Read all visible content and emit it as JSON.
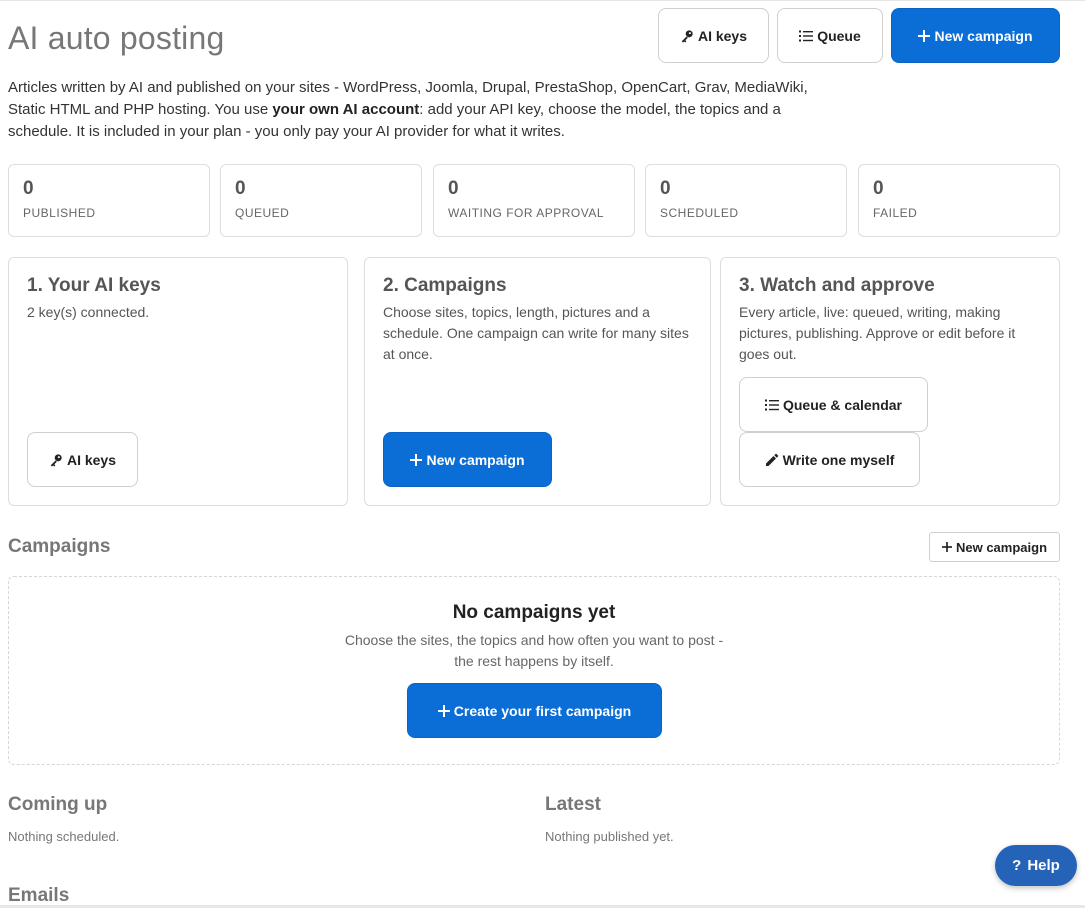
{
  "header": {
    "title": "AI auto posting",
    "ai_keys_label": "AI keys",
    "queue_label": "Queue",
    "new_campaign_label": "New campaign"
  },
  "intro": {
    "part1": "Articles written by AI and published on your sites - WordPress, Joomla, Drupal, PrestaShop, OpenCart, Grav, MediaWiki, Static HTML and PHP hosting. You use ",
    "bold": "your own AI account",
    "part2": ": add your API key, choose the model, the topics and a schedule. It is included in your plan - you only pay your AI provider for what it writes."
  },
  "stats": [
    {
      "value": "0",
      "label": "PUBLISHED"
    },
    {
      "value": "0",
      "label": "QUEUED"
    },
    {
      "value": "0",
      "label": "WAITING FOR APPROVAL"
    },
    {
      "value": "0",
      "label": "SCHEDULED"
    },
    {
      "value": "0",
      "label": "FAILED"
    }
  ],
  "steps": {
    "keys": {
      "title": "1. Your AI keys",
      "text": "2 key(s) connected.",
      "button": "AI keys"
    },
    "campaigns": {
      "title": "2. Campaigns",
      "text": "Choose sites, topics, length, pictures and a schedule. One campaign can write for many sites at once.",
      "button": "New campaign"
    },
    "watch": {
      "title": "3. Watch and approve",
      "text": "Every article, live: queued, writing, making pictures, publishing. Approve or edit before it goes out.",
      "button_queue": "Queue & calendar",
      "button_write": "Write one myself"
    }
  },
  "campaigns_section": {
    "title": "Campaigns",
    "new_button": "New campaign",
    "empty_title": "No campaigns yet",
    "empty_line1": "Choose the sites, the topics and how often you want to post -",
    "empty_line2": "the rest happens by itself.",
    "create_button": "Create your first campaign"
  },
  "coming_up": {
    "title": "Coming up",
    "text": "Nothing scheduled."
  },
  "latest": {
    "title": "Latest",
    "text": "Nothing published yet."
  },
  "emails": {
    "title": "Emails"
  },
  "help": {
    "label": "Help",
    "glyph": "?"
  },
  "colors": {
    "primary": "#0a6ed6",
    "help": "#2563b8"
  },
  "icons": [
    "key-icon",
    "list-icon",
    "plus-icon",
    "pencil-icon",
    "question-icon"
  ]
}
